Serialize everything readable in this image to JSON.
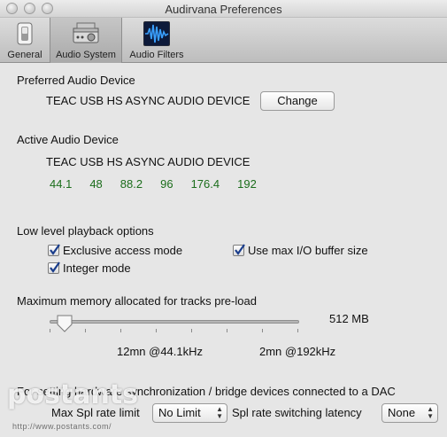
{
  "window": {
    "title": "Audirvana Preferences"
  },
  "toolbar": {
    "items": [
      {
        "label": "General",
        "icon": "switch-icon"
      },
      {
        "label": "Audio System",
        "icon": "amplifier-icon",
        "selected": true
      },
      {
        "label": "Audio Filters",
        "icon": "waveform-icon"
      }
    ]
  },
  "preferred": {
    "heading": "Preferred Audio Device",
    "device": "TEAC USB HS ASYNC AUDIO DEVICE",
    "change_label": "Change"
  },
  "active": {
    "heading": "Active Audio Device",
    "device": "TEAC USB HS ASYNC AUDIO DEVICE",
    "rates": [
      "44.1",
      "48",
      "88.2",
      "96",
      "176.4",
      "192"
    ],
    "rate_color": "#1b6d1b"
  },
  "playback": {
    "heading": "Low level playback options",
    "exclusive_label": "Exclusive access mode",
    "exclusive_checked": true,
    "maxio_label": "Use max I/O buffer size",
    "maxio_checked": true,
    "integer_label": "Integer mode",
    "integer_checked": true
  },
  "memory": {
    "heading": "Maximum memory allocated for tracks pre-load",
    "value": "512 MB",
    "level": 0.04,
    "at_44": "12mn @44.1kHz",
    "at_192": "2mn @192kHz"
  },
  "hardware": {
    "sync_text": "For setting hardware synchronization / bridge devices connected to a DAC",
    "limit_label": "Max Spl rate limit",
    "limit_value": "No Limit",
    "latency_label": "Spl rate switching latency",
    "latency_value": "None"
  },
  "watermark": {
    "logo": "postants",
    "url": "http://www.postants.com/"
  }
}
